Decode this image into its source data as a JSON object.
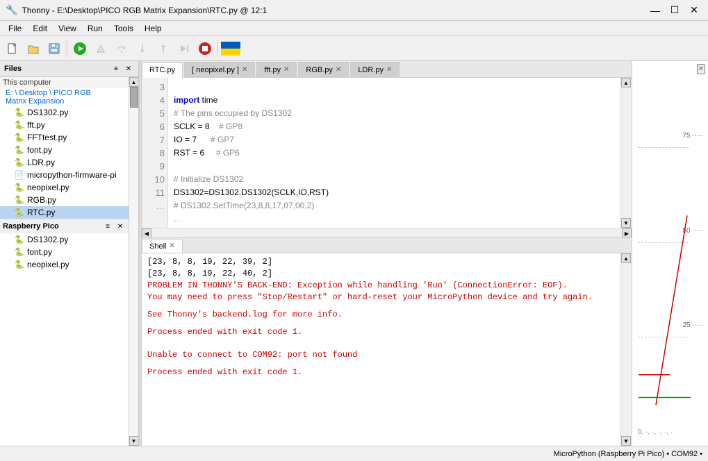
{
  "titlebar": {
    "icon": "🔧",
    "title": "Thonny - E:\\Desktop\\PICO RGB Matrix Expansion\\RTC.py @ 12:1",
    "min": "—",
    "max": "☐",
    "close": "✕"
  },
  "menubar": {
    "items": [
      "File",
      "Edit",
      "View",
      "Run",
      "Tools",
      "Help"
    ]
  },
  "toolbar": {
    "buttons": [
      "new",
      "open",
      "save",
      "run",
      "debug",
      "step_over",
      "step_into",
      "step_out",
      "resume",
      "stop"
    ]
  },
  "files_panel": {
    "header": "Files",
    "this_computer": "This computer",
    "path": "E: \\ Desktop \\ PICO RGB Matrix Expansion",
    "files": [
      {
        "name": "DS1302.py"
      },
      {
        "name": "fft.py"
      },
      {
        "name": "FFTtest.py"
      },
      {
        "name": "font.py"
      },
      {
        "name": "LDR.py"
      },
      {
        "name": "micropython-firmware-pi"
      },
      {
        "name": "neopixel.py"
      },
      {
        "name": "RGB.py"
      },
      {
        "name": "RTC.py",
        "selected": true
      }
    ],
    "raspberry_pi_pico": "Raspberry Pico",
    "pico_files": [
      {
        "name": "DS1302.py"
      },
      {
        "name": "font.py"
      },
      {
        "name": "neopixel.py"
      }
    ]
  },
  "tabs": [
    {
      "label": "RTC.py",
      "active": true,
      "closable": false
    },
    {
      "label": "[ neopixel.py ]",
      "active": false,
      "closable": true
    },
    {
      "label": "fft.py",
      "active": false,
      "closable": true
    },
    {
      "label": "RGB.py",
      "active": false,
      "closable": true
    },
    {
      "label": "LDR.py",
      "active": false,
      "closable": true
    }
  ],
  "code": {
    "lines": [
      {
        "num": 3,
        "text": "import time",
        "tokens": [
          {
            "type": "kw",
            "text": "import"
          },
          {
            "type": "normal",
            "text": " time"
          }
        ]
      },
      {
        "num": 4,
        "text": "# The pins occupied by DS1302",
        "tokens": [
          {
            "type": "cm",
            "text": "# The pins occupied by DS1302"
          }
        ]
      },
      {
        "num": 5,
        "text": "SCLK = 8    # GP8",
        "tokens": [
          {
            "type": "normal",
            "text": "SCLK = 8    "
          },
          {
            "type": "cm",
            "text": "# GP8"
          }
        ]
      },
      {
        "num": 6,
        "text": "IO = 7      # GP7",
        "tokens": [
          {
            "type": "normal",
            "text": "IO = 7      "
          },
          {
            "type": "cm",
            "text": "# GP7"
          }
        ]
      },
      {
        "num": 7,
        "text": "RST = 6     # GP6",
        "tokens": [
          {
            "type": "normal",
            "text": "RST = 6     "
          },
          {
            "type": "cm",
            "text": "# GP6"
          }
        ]
      },
      {
        "num": 8,
        "text": ""
      },
      {
        "num": 9,
        "text": "# Initialize DS1302",
        "tokens": [
          {
            "type": "cm",
            "text": "# Initialize DS1302"
          }
        ]
      },
      {
        "num": 10,
        "text": "DS1302=DS1302.DS1302(SCLK,IO,RST)"
      },
      {
        "num": 11,
        "text": "# DS1302.SetTime(23,8,8,17,07,00,2)",
        "tokens": [
          {
            "type": "cm",
            "text": "# DS1302.SetTime(23,8,8,17,07,00,2)"
          }
        ]
      }
    ]
  },
  "shell": {
    "tab_label": "Shell",
    "lines": [
      {
        "type": "normal",
        "text": "[23, 8, 8, 19, 22, 39, 2]"
      },
      {
        "type": "normal",
        "text": "[23, 8, 8, 19, 22, 40, 2]"
      },
      {
        "type": "error",
        "text": "PROBLEM IN THONNY'S BACK-END: Exception while handling 'Run' (ConnectionError: EOF)."
      },
      {
        "type": "error",
        "text": "You may need to press \"Stop/Restart\" or hard-reset your MicroPython device and try again."
      },
      {
        "type": "blank",
        "text": ""
      },
      {
        "type": "error",
        "text": "See Thonny's backend.log for more info."
      },
      {
        "type": "blank",
        "text": ""
      },
      {
        "type": "error",
        "text": "Process ended with exit code 1."
      },
      {
        "type": "blank",
        "text": ""
      },
      {
        "type": "blank",
        "text": ""
      },
      {
        "type": "error",
        "text": "Unable to connect to COM92: port not found"
      },
      {
        "type": "blank",
        "text": ""
      },
      {
        "type": "error",
        "text": "Process ended with exit code 1."
      }
    ]
  },
  "graph": {
    "labels": [
      "75",
      "50",
      "25"
    ]
  },
  "statusbar": {
    "text": "MicroPython (Raspberry Pi Pico)  •  COM92  •"
  }
}
